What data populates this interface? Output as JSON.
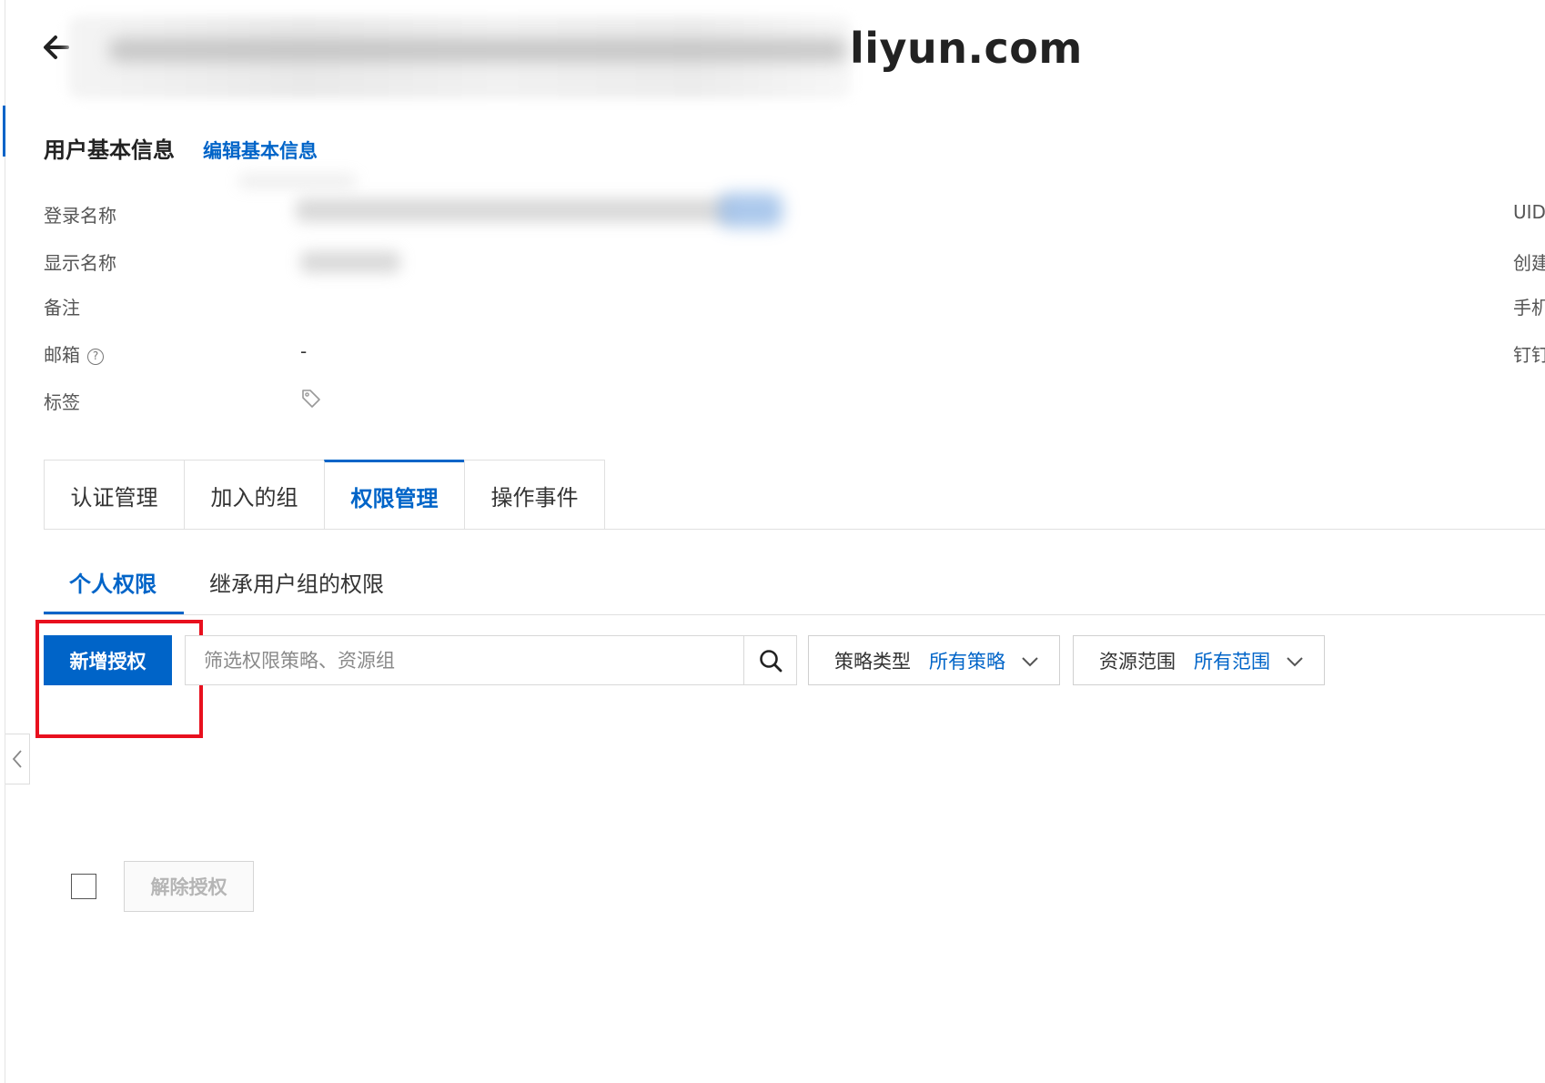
{
  "header": {
    "title_visible_suffix": "liyun.com"
  },
  "basic_info": {
    "section_title": "用户基本信息",
    "edit_link": "编辑基本信息",
    "fields": {
      "login_name_label": "登录名称",
      "display_name_label": "显示名称",
      "remark_label": "备注",
      "email_label": "邮箱",
      "email_value": "-",
      "tags_label": "标签"
    },
    "right_column": {
      "uid_label": "UID",
      "created_label": "创建",
      "phone_label": "手机",
      "dingtalk_label": "钉钉"
    }
  },
  "tabs": [
    {
      "label": "认证管理",
      "active": false
    },
    {
      "label": "加入的组",
      "active": false
    },
    {
      "label": "权限管理",
      "active": true
    },
    {
      "label": "操作事件",
      "active": false
    }
  ],
  "subtabs": [
    {
      "label": "个人权限",
      "active": true
    },
    {
      "label": "继承用户组的权限",
      "active": false
    }
  ],
  "toolbar": {
    "add_button": "新增授权",
    "search_placeholder": "筛选权限策略、资源组",
    "policy_type": {
      "label": "策略类型",
      "value": "所有策略"
    },
    "resource_scope": {
      "label": "资源范围",
      "value": "所有范围"
    }
  },
  "table_actions": {
    "unbind_button": "解除授权"
  },
  "colors": {
    "primary": "#0064c8",
    "highlight_box": "#e8101e"
  }
}
